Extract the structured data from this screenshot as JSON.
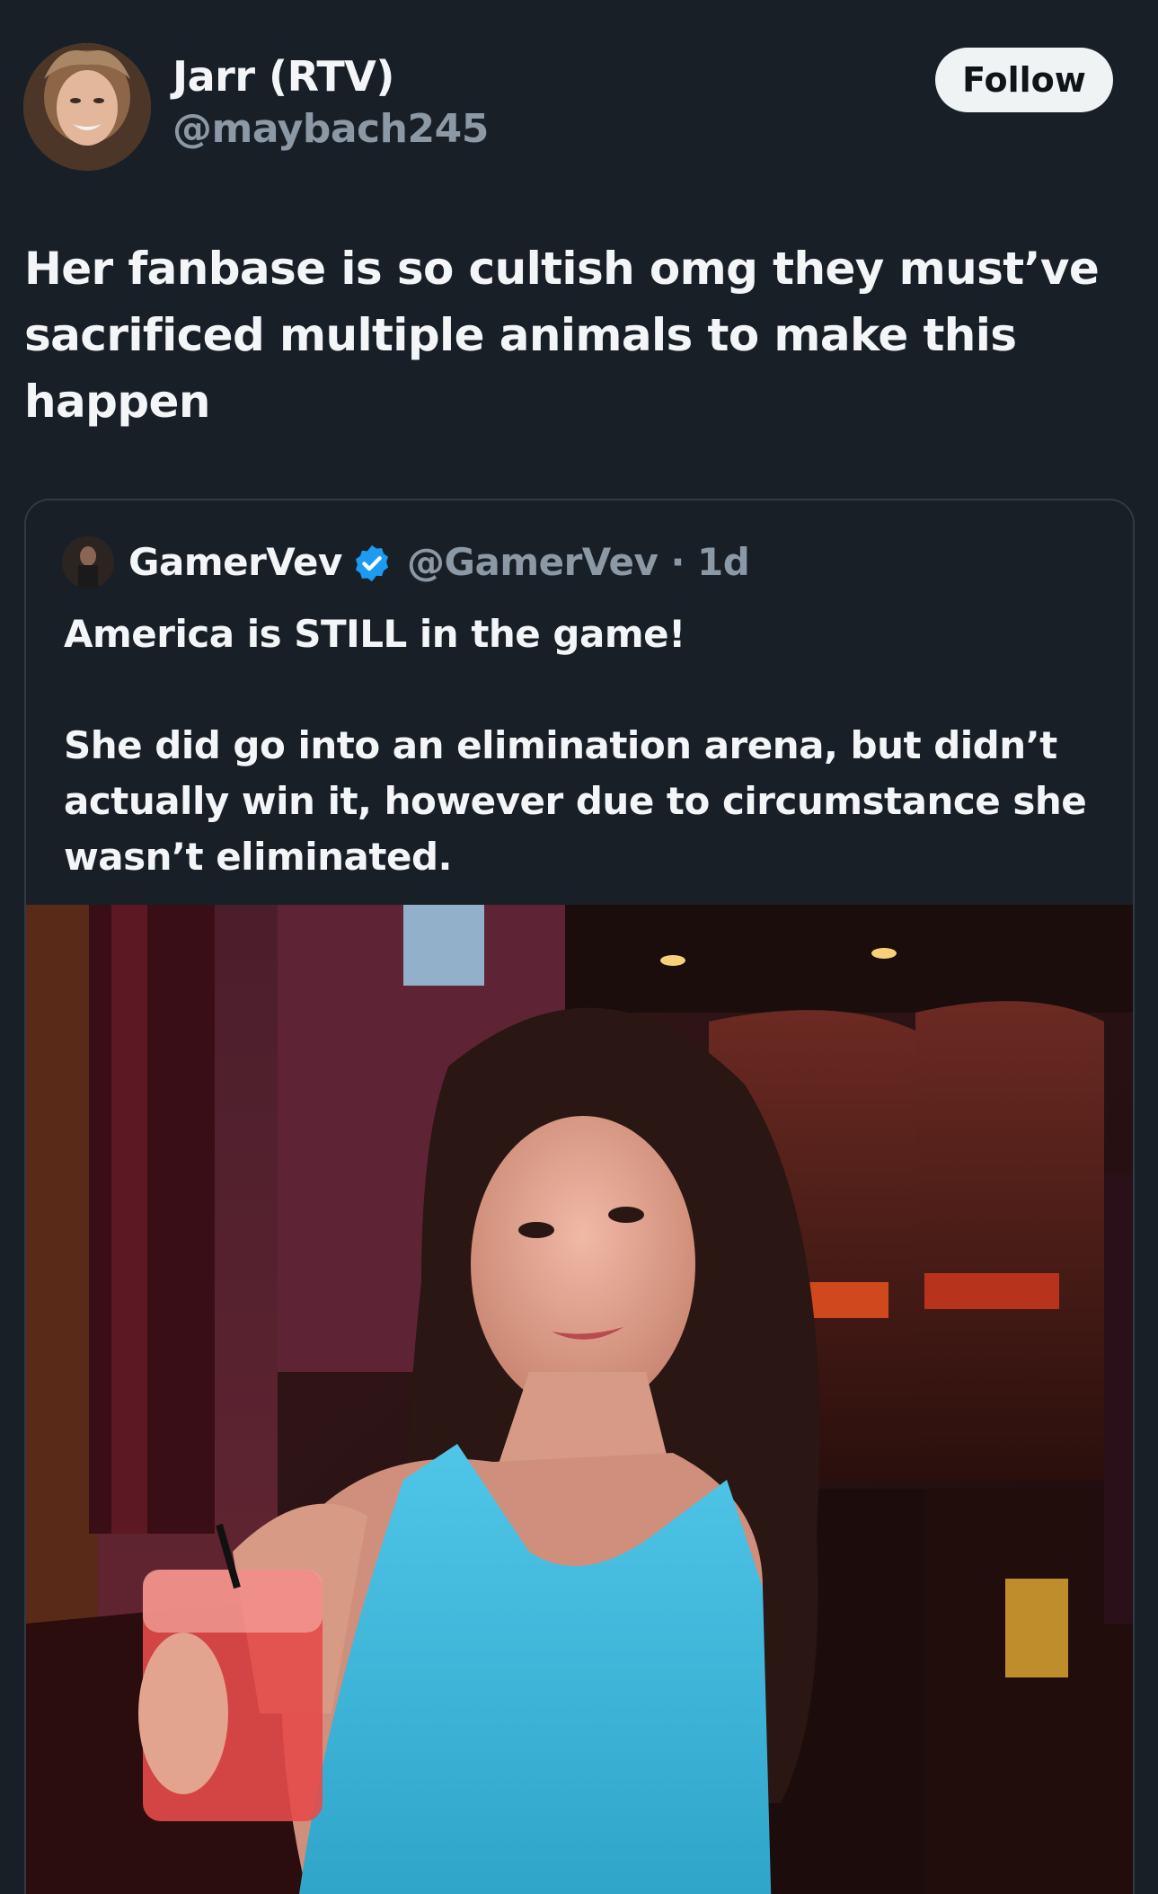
{
  "author": {
    "display_name": "Jarr (RTV)",
    "handle": "@maybach245",
    "follow_label": "Follow"
  },
  "tweet": {
    "text": "Her fanbase is so cultish omg they must’ve sacrificed multiple animals to make this happen"
  },
  "quoted": {
    "display_name": "GamerVev",
    "handle_time": "@GamerVev · 1d",
    "text": "America is STILL in the game!\n\nShe did go into an elimination arena, but didn’t actually win it, however due to circumstance she wasn’t eliminated.",
    "verified_color": "#1d9bf0"
  },
  "colors": {
    "background": "#191f27",
    "text_primary": "#f3f5f7",
    "text_secondary": "#8b98a5",
    "follow_bg": "#eff3f4"
  }
}
